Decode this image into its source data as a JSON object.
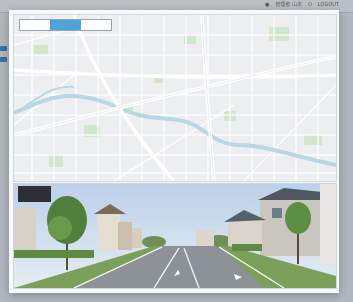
{
  "app": {
    "user_menu": [
      "管理者 山本",
      "LOGOUT"
    ],
    "side_badges": 2
  },
  "map": {
    "tabs": [
      {
        "label": "",
        "active": false
      },
      {
        "label": "",
        "active": true
      },
      {
        "label": "",
        "active": false
      }
    ],
    "colors": {
      "land": "#eceef0",
      "park": "#cfe8cc",
      "water": "#b7d8e4",
      "road": "#ffffff",
      "major_road": "#f7f7f7"
    }
  },
  "street_view": {
    "location_label": "",
    "colors": {
      "sky": "#c9d9ec",
      "road": "#8d9198",
      "grass": "#7aa05a",
      "tree": "#4f7f3a"
    }
  }
}
